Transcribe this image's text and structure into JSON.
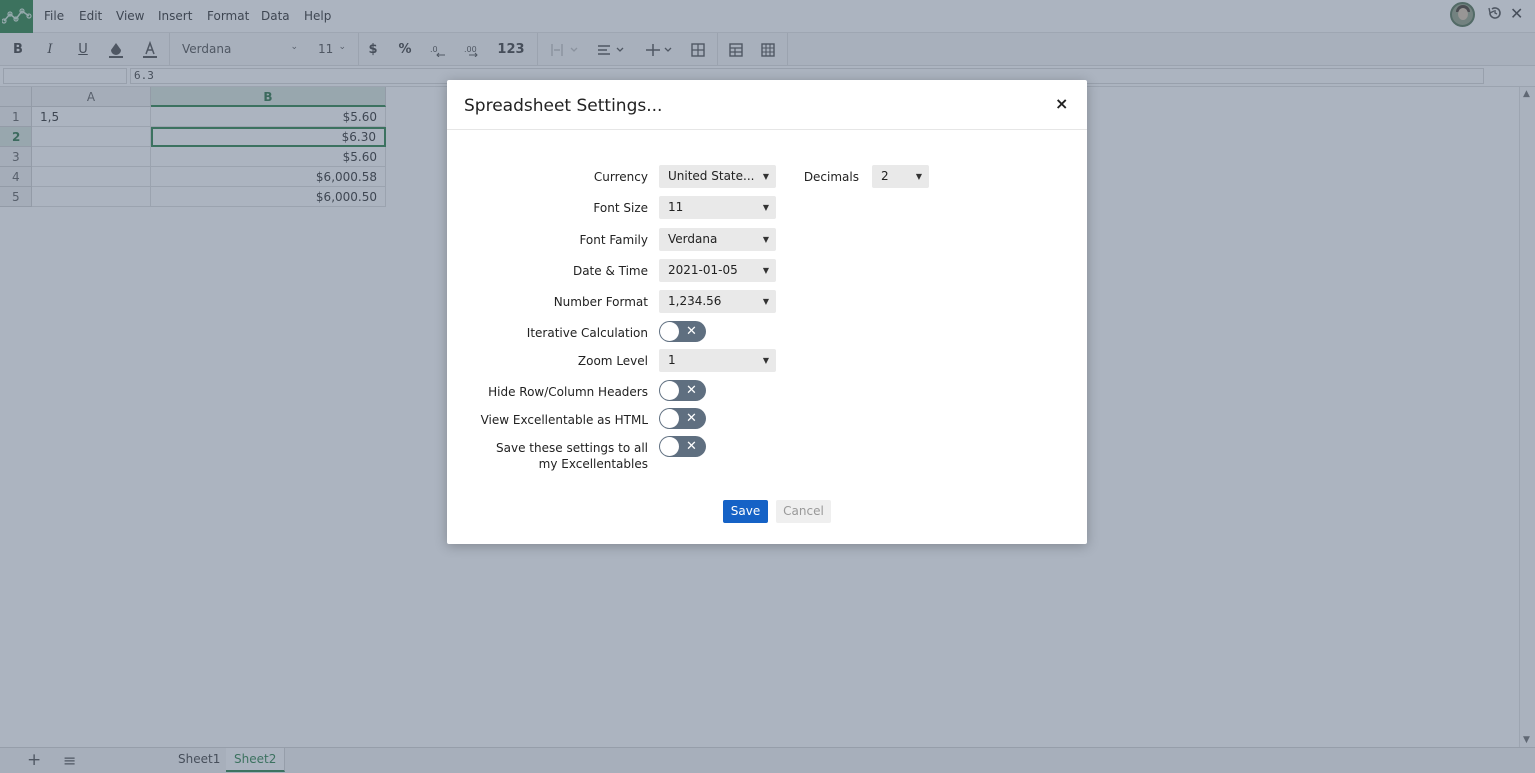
{
  "menu": [
    "File",
    "Edit",
    "View",
    "Insert",
    "Format",
    "Data",
    "Help"
  ],
  "toolbar": {
    "font_family": "Verdana",
    "font_size": "11",
    "currency_symbol": "$",
    "percent_symbol": "%",
    "number_format_label": "123"
  },
  "formula": {
    "cell_ref": "",
    "value": "6.3"
  },
  "grid": {
    "columns": [
      "A",
      "B"
    ],
    "selected_column": "B",
    "selected_row": 2,
    "rows": [
      {
        "row": "1",
        "a": "1,5",
        "b": "$5.60"
      },
      {
        "row": "2",
        "a": "",
        "b": "$6.30"
      },
      {
        "row": "3",
        "a": "",
        "b": "$5.60"
      },
      {
        "row": "4",
        "a": "",
        "b": "$6,000.58"
      },
      {
        "row": "5",
        "a": "",
        "b": "$6,000.50"
      }
    ]
  },
  "sheets": [
    "Sheet1",
    "Sheet2"
  ],
  "active_sheet": "Sheet2",
  "accent_color": "#1e7a3e",
  "modal": {
    "title": "Spreadsheet Settings...",
    "close": "×",
    "currency_label": "Currency",
    "currency_value": "United State...",
    "decimals_label": "Decimals",
    "decimals_value": "2",
    "font_size_label": "Font Size",
    "font_size_value": "11",
    "font_family_label": "Font Family",
    "font_family_value": "Verdana",
    "date_time_label": "Date & Time",
    "date_time_value": "2021-01-05",
    "number_format_label": "Number Format",
    "number_format_value": "1,234.56",
    "iterative_label": "Iterative Calculation",
    "iterative_on": false,
    "zoom_label": "Zoom Level",
    "zoom_value": "1",
    "hide_headers_label": "Hide Row/Column Headers",
    "hide_headers_on": false,
    "view_html_label": "View Excellentable as HTML",
    "view_html_on": false,
    "save_all_label_line1": "Save these settings to all",
    "save_all_label_line2": "my Excellentables",
    "save_all_on": false,
    "save_button": "Save",
    "cancel_button": "Cancel",
    "primary_color": "#1562c6"
  }
}
